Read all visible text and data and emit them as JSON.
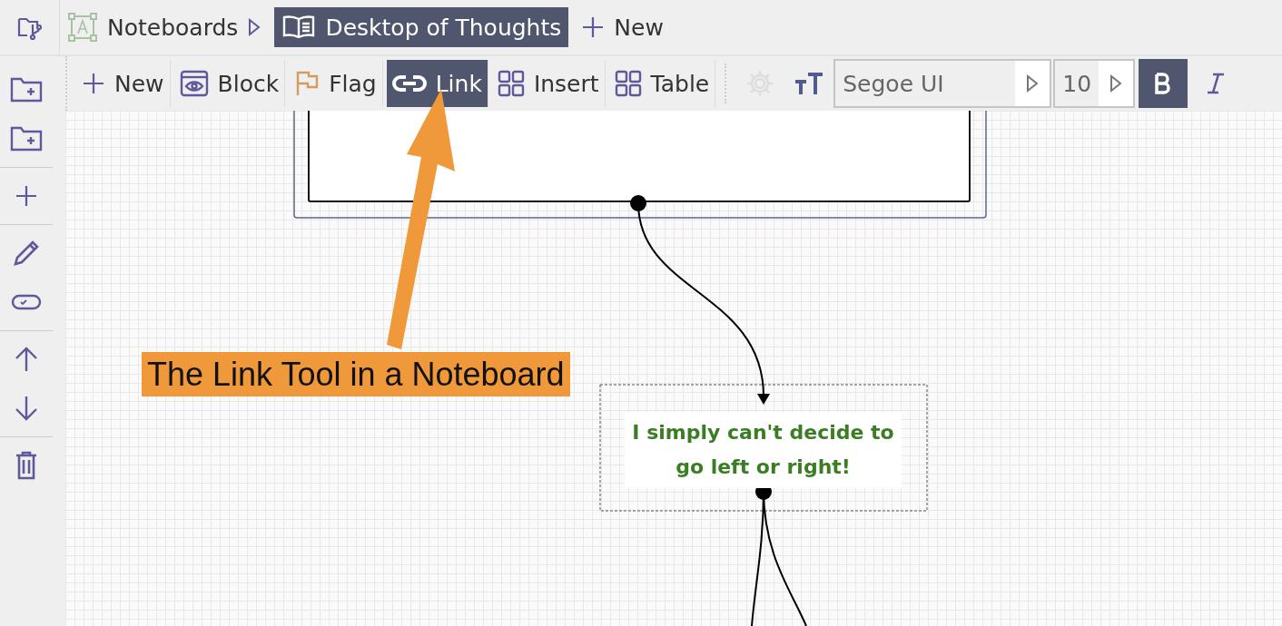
{
  "tabs": [
    {
      "kind": "root",
      "label": "Noteboards",
      "selected": false
    },
    {
      "kind": "board",
      "label": "Desktop of Thoughts",
      "selected": true
    },
    {
      "kind": "new",
      "label": "New",
      "selected": false
    }
  ],
  "toolbar": {
    "tools": [
      {
        "kind": "new",
        "label": "New",
        "selected": false
      },
      {
        "kind": "block",
        "label": "Block",
        "selected": false
      },
      {
        "kind": "flag",
        "label": "Flag",
        "selected": false
      },
      {
        "kind": "link",
        "label": "Link",
        "selected": true
      },
      {
        "kind": "insert",
        "label": "Insert",
        "selected": false
      },
      {
        "kind": "table",
        "label": "Table",
        "selected": false
      }
    ],
    "settings_disabled": true,
    "font": {
      "value": "Segoe UI"
    },
    "size": {
      "value": "10"
    },
    "bold": true,
    "italic": false
  },
  "canvas": {
    "note": {
      "text": "I simply can't decide to go left or right!"
    }
  },
  "annotation": {
    "text": "The Link Tool in a Noteboard"
  }
}
